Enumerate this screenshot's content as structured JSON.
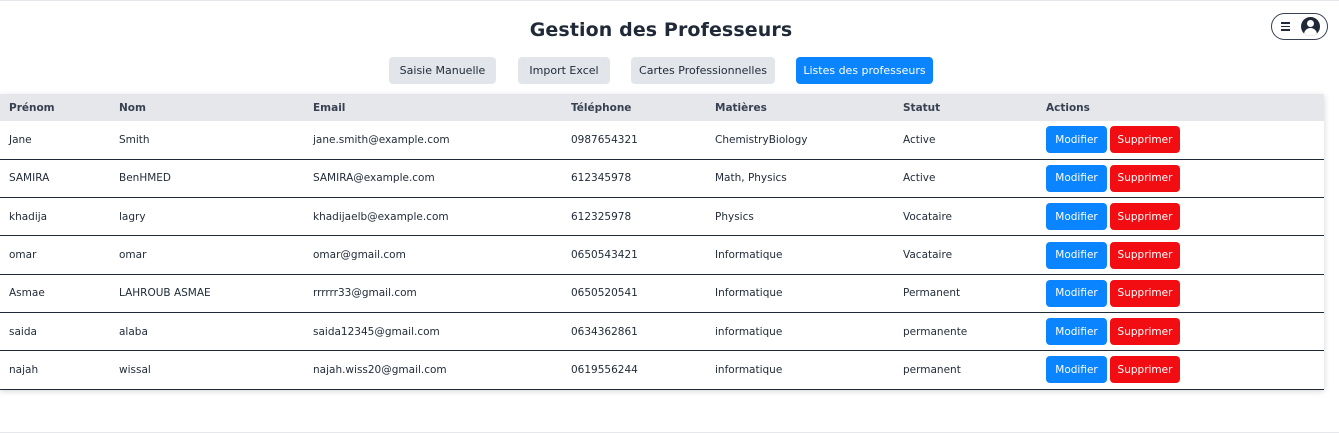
{
  "header": {
    "title": "Gestion des Professeurs"
  },
  "user_menu": {
    "menu_icon": "hamburger-icon",
    "avatar_icon": "user-avatar-icon"
  },
  "tabs": [
    {
      "label": "Saisie Manuelle",
      "active": false
    },
    {
      "label": "Import Excel",
      "active": false
    },
    {
      "label": "Cartes Professionnelles",
      "active": false
    },
    {
      "label": "Listes des professeurs",
      "active": true
    }
  ],
  "colors": {
    "primary": "#0a84ff",
    "danger": "#f20d12",
    "header_bg": "#e5e7eb",
    "tab_bg": "#e2e6ea"
  },
  "table": {
    "columns": [
      "Prénom",
      "Nom",
      "Email",
      "Téléphone",
      "Matières",
      "Statut",
      "Actions"
    ],
    "edit_label": "Modifier",
    "delete_label": "Supprimer",
    "rows": [
      {
        "prenom": "Jane",
        "nom": "Smith",
        "email": "jane.smith@example.com",
        "telephone": "0987654321",
        "matieres": "ChemistryBiology",
        "statut": "Active"
      },
      {
        "prenom": "SAMIRA",
        "nom": "BenHMED",
        "email": "SAMIRA@example.com",
        "telephone": "612345978",
        "matieres": "Math, Physics",
        "statut": "Active"
      },
      {
        "prenom": "khadija",
        "nom": "lagry",
        "email": "khadijaelb@example.com",
        "telephone": "612325978",
        "matieres": "Physics",
        "statut": "Vocataire"
      },
      {
        "prenom": "omar",
        "nom": "omar",
        "email": "omar@gmail.com",
        "telephone": "0650543421",
        "matieres": "Informatique",
        "statut": "Vacataire"
      },
      {
        "prenom": "Asmae",
        "nom": "LAHROUB ASMAE",
        "email": "rrrrrr33@gmail.com",
        "telephone": "0650520541",
        "matieres": "Informatique",
        "statut": "Permanent"
      },
      {
        "prenom": "saida",
        "nom": "alaba",
        "email": "saida12345@gmail.com",
        "telephone": "0634362861",
        "matieres": "informatique",
        "statut": "permanente"
      },
      {
        "prenom": "najah",
        "nom": "wissal",
        "email": "najah.wiss20@gmail.com",
        "telephone": "0619556244",
        "matieres": "informatique",
        "statut": "permanent"
      }
    ]
  }
}
